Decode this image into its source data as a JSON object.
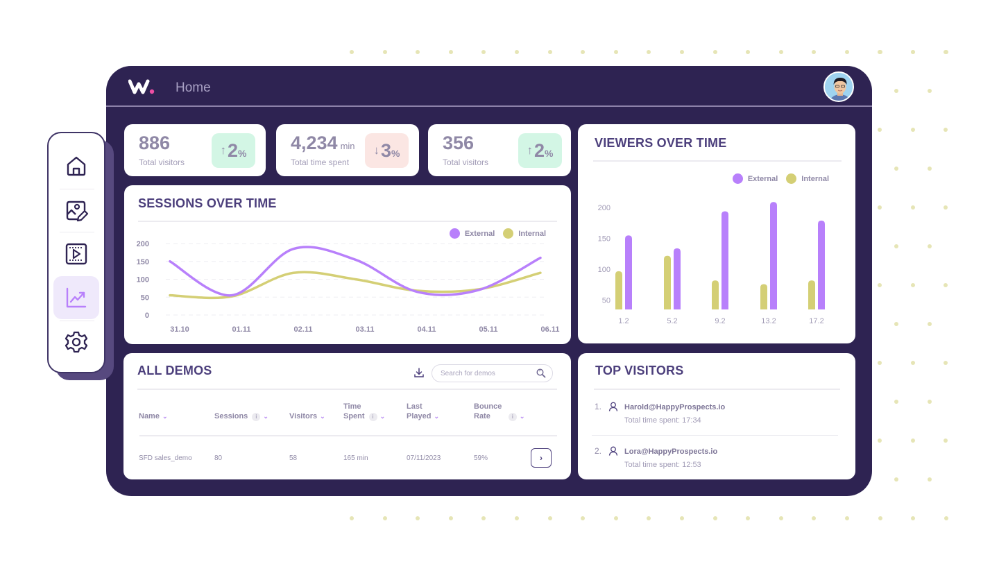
{
  "header": {
    "logo": "w-logo",
    "title": "Home",
    "avatar": "user-avatar"
  },
  "colors": {
    "external": "#b880fb",
    "internal": "#d4cf75",
    "window_bg": "#2e2352",
    "title": "#4c3f7c",
    "up_badge": "#d3f6e5",
    "down_badge": "#fbe6e3"
  },
  "sidebar": {
    "items": [
      {
        "name": "home",
        "icon": "home-icon",
        "active": false
      },
      {
        "name": "image-edit",
        "icon": "image-edit-icon",
        "active": false
      },
      {
        "name": "video",
        "icon": "video-icon",
        "active": false
      },
      {
        "name": "analytics",
        "icon": "chart-trending-icon",
        "active": true
      },
      {
        "name": "settings",
        "icon": "gear-icon",
        "active": false
      }
    ]
  },
  "stats": [
    {
      "value": "886",
      "unit": "",
      "label": "Total visitors",
      "trend": "up",
      "arrow": "↑",
      "change": "2",
      "pct": "%"
    },
    {
      "value": "4,234",
      "unit": "min",
      "label": "Total time spent",
      "trend": "down",
      "arrow": "↓",
      "change": "3",
      "pct": "%"
    },
    {
      "value": "356",
      "unit": "",
      "label": "Total visitors",
      "trend": "up",
      "arrow": "↑",
      "change": "2",
      "pct": "%"
    }
  ],
  "chart_data": [
    {
      "type": "line",
      "title": "SESSIONS OVER TIME",
      "x": [
        "31.10",
        "01.11",
        "02.11",
        "03.11",
        "04.11",
        "05.11",
        "06.11"
      ],
      "yticks": [
        0,
        50,
        100,
        150,
        200
      ],
      "ylim": [
        0,
        200
      ],
      "grid": true,
      "legend": "top-right",
      "series": [
        {
          "name": "External",
          "color": "#b880fb",
          "values": [
            150,
            55,
            185,
            155,
            65,
            70,
            160
          ]
        },
        {
          "name": "Internal",
          "color": "#d4cf75",
          "values": [
            55,
            52,
            118,
            100,
            68,
            72,
            118
          ]
        }
      ]
    },
    {
      "type": "bar",
      "title": "VIEWERS OVER TIME",
      "categories": [
        "1.2",
        "5.2",
        "9.2",
        "13.2",
        "17.2"
      ],
      "yticks": [
        50,
        100,
        150,
        200
      ],
      "ylim": [
        35,
        215
      ],
      "grid": false,
      "legend": "top-right",
      "series": [
        {
          "name": "Internal",
          "color": "#d4cf75",
          "values": [
            97,
            122,
            82,
            76,
            82
          ]
        },
        {
          "name": "External",
          "color": "#b880fb",
          "values": [
            155,
            134,
            194,
            209,
            179
          ]
        }
      ]
    }
  ],
  "demos": {
    "title": "ALL DEMOS",
    "download_icon": "download-icon",
    "search_placeholder": "Search for demos",
    "search_value": "",
    "columns": [
      {
        "line1": "Name",
        "line2": "",
        "info": false
      },
      {
        "line1": "Sessions",
        "line2": "",
        "info": true
      },
      {
        "line1": "Visitors",
        "line2": "",
        "info": false
      },
      {
        "line1": "Time",
        "line2": "Spent",
        "info": true
      },
      {
        "line1": "Last",
        "line2": "Played",
        "info": false
      },
      {
        "line1": "Bounce",
        "line2": "Rate",
        "info": true
      }
    ],
    "rows": [
      {
        "name": "SFD sales_demo",
        "sessions": "80",
        "visitors": "58",
        "time_spent": "165 min",
        "last_played": "07/11/2023",
        "bounce_rate": "59%",
        "action": "›"
      }
    ]
  },
  "top_visitors": {
    "title": "TOP VISITORS",
    "items": [
      {
        "rank": "1.",
        "email": "Harold@HappyProspects.io",
        "time": "Total time spent: 17:34"
      },
      {
        "rank": "2.",
        "email": "Lora@HappyProspects.io",
        "time": "Total time spent: 12:53"
      }
    ]
  },
  "info_glyph": "i",
  "chevron_glyph": "⌄"
}
